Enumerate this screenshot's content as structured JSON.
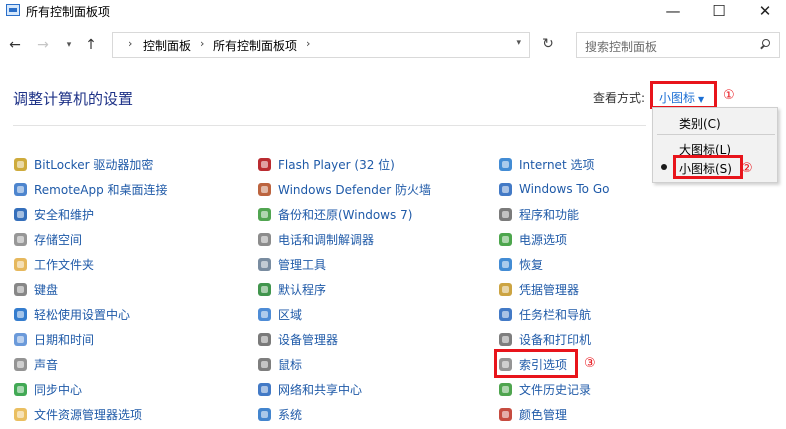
{
  "window": {
    "title": "所有控制面板项",
    "minimize": "—",
    "maximize": "☐",
    "close": "✕"
  },
  "nav": {
    "back": "←",
    "forward": "→",
    "dropdown": "▾",
    "up": "↑",
    "refresh": "↻"
  },
  "breadcrumb": {
    "sep": "›",
    "items": [
      "控制面板",
      "所有控制面板项"
    ],
    "dropdown": "▾"
  },
  "search": {
    "placeholder": "搜索控制面板"
  },
  "header": {
    "title": "调整计算机的设置",
    "view_label": "查看方式:",
    "view_value": "小图标",
    "caret": "▼"
  },
  "menu": {
    "items": [
      "类别(C)",
      "大图标(L)",
      "小图标(S)"
    ]
  },
  "annotations": [
    "①",
    "②",
    "③"
  ],
  "columns": [
    {
      "items": [
        {
          "label": "BitLocker 驱动器加密",
          "icon": "bitlocker-key-icon",
          "color": "#c9a227"
        },
        {
          "label": "RemoteApp 和桌面连接",
          "icon": "remoteapp-icon",
          "color": "#3a78c9"
        },
        {
          "label": "安全和维护",
          "icon": "flag-icon",
          "color": "#1f5fb4"
        },
        {
          "label": "存储空间",
          "icon": "storage-icon",
          "color": "#8c8c8c"
        },
        {
          "label": "工作文件夹",
          "icon": "work-folder-icon",
          "color": "#e3b04b"
        },
        {
          "label": "键盘",
          "icon": "keyboard-icon",
          "color": "#7a7a7a"
        },
        {
          "label": "轻松使用设置中心",
          "icon": "ease-of-access-icon",
          "color": "#1f6fc9"
        },
        {
          "label": "日期和时间",
          "icon": "clock-icon",
          "color": "#5b8fd6"
        },
        {
          "label": "声音",
          "icon": "speaker-icon",
          "color": "#888888"
        },
        {
          "label": "同步中心",
          "icon": "sync-icon",
          "color": "#2ea043"
        },
        {
          "label": "文件资源管理器选项",
          "icon": "folder-options-icon",
          "color": "#e8b850"
        }
      ]
    },
    {
      "items": [
        {
          "label": "Flash Player (32 位)",
          "icon": "flash-icon",
          "color": "#b3151b"
        },
        {
          "label": "Windows Defender 防火墙",
          "icon": "firewall-icon",
          "color": "#b5532a"
        },
        {
          "label": "备份和还原(Windows 7)",
          "icon": "backup-icon",
          "color": "#3e9b3e"
        },
        {
          "label": "电话和调制解调器",
          "icon": "phone-modem-icon",
          "color": "#808080"
        },
        {
          "label": "管理工具",
          "icon": "admin-tools-icon",
          "color": "#6a7f96"
        },
        {
          "label": "默认程序",
          "icon": "default-programs-icon",
          "color": "#2c8a3a"
        },
        {
          "label": "区域",
          "icon": "region-globe-icon",
          "color": "#3b7fd1"
        },
        {
          "label": "设备管理器",
          "icon": "device-manager-icon",
          "color": "#6b6b6b"
        },
        {
          "label": "鼠标",
          "icon": "mouse-icon",
          "color": "#707070"
        },
        {
          "label": "网络和共享中心",
          "icon": "network-icon",
          "color": "#2f6cc0"
        },
        {
          "label": "系统",
          "icon": "system-icon",
          "color": "#2f78c9"
        }
      ]
    },
    {
      "items": [
        {
          "label": "Internet 选项",
          "icon": "internet-options-icon",
          "color": "#2f7fcf"
        },
        {
          "label": "Windows To Go",
          "icon": "windows-to-go-icon",
          "color": "#2f6cc0"
        },
        {
          "label": "程序和功能",
          "icon": "programs-icon",
          "color": "#6d6d6d"
        },
        {
          "label": "电源选项",
          "icon": "power-icon",
          "color": "#3a9c3a"
        },
        {
          "label": "恢复",
          "icon": "recovery-icon",
          "color": "#2f80cf"
        },
        {
          "label": "凭据管理器",
          "icon": "credential-icon",
          "color": "#c79a2e"
        },
        {
          "label": "任务栏和导航",
          "icon": "taskbar-icon",
          "color": "#2f6cc0"
        },
        {
          "label": "设备和打印机",
          "icon": "printer-icon",
          "color": "#707070"
        },
        {
          "label": "索引选项",
          "icon": "indexing-icon",
          "color": "#8a8a8a"
        },
        {
          "label": "文件历史记录",
          "icon": "file-history-icon",
          "color": "#3c9b3c"
        },
        {
          "label": "颜色管理",
          "icon": "color-management-icon",
          "color": "#c0392b"
        }
      ]
    }
  ]
}
